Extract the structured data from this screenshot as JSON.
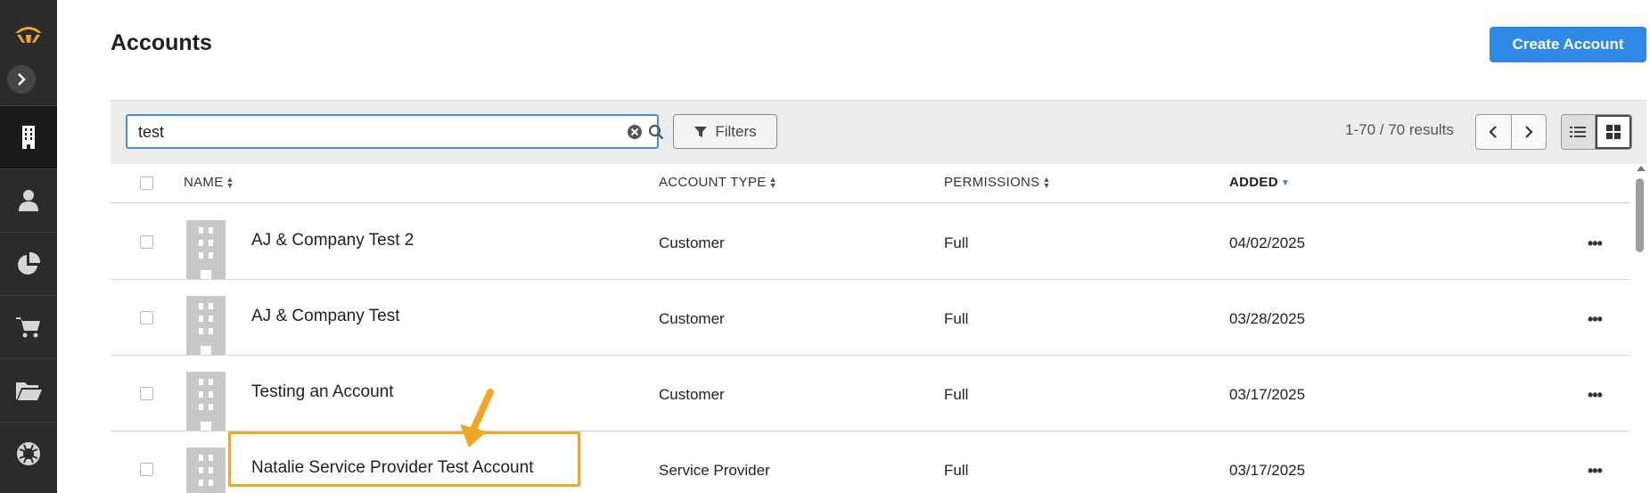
{
  "sidebar": {
    "items": [
      {
        "icon": "building-icon",
        "active": true
      },
      {
        "icon": "user-icon",
        "active": false
      },
      {
        "icon": "pie-chart-icon",
        "active": false
      },
      {
        "icon": "cart-icon",
        "active": false
      },
      {
        "icon": "folder-icon",
        "active": false
      },
      {
        "icon": "lifebuoy-icon",
        "active": false
      }
    ]
  },
  "header": {
    "title": "Accounts",
    "create_label": "Create Account"
  },
  "toolbar": {
    "search_value": "test",
    "filters_label": "Filters",
    "results_text": "1-70 / 70 results"
  },
  "table": {
    "columns": {
      "name": "NAME",
      "type": "ACCOUNT TYPE",
      "permissions": "PERMISSIONS",
      "added": "ADDED"
    },
    "rows": [
      {
        "name": "AJ & Company Test 2",
        "type": "Customer",
        "permissions": "Full",
        "added": "04/02/2025"
      },
      {
        "name": "AJ & Company Test",
        "type": "Customer",
        "permissions": "Full",
        "added": "03/28/2025"
      },
      {
        "name": "Testing an Account",
        "type": "Customer",
        "permissions": "Full",
        "added": "03/17/2025"
      },
      {
        "name": "Natalie Service Provider Test Account",
        "type": "Service Provider",
        "permissions": "Full",
        "added": "03/17/2025"
      }
    ],
    "more_label": "•••"
  },
  "colors": {
    "accent": "#2e8ae6",
    "highlight": "#f0a724",
    "sidebar": "#2b2b2b"
  }
}
